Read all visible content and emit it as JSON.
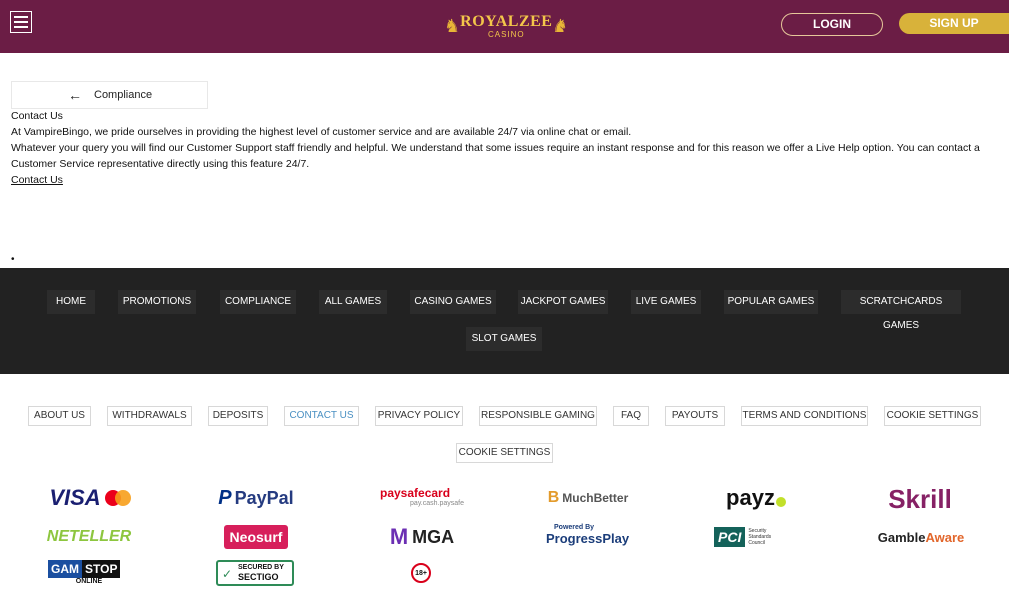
{
  "header": {
    "brand": "ROYALZEE",
    "brand_sub": "CASINO",
    "login": "LOGIN",
    "signup": "SIGN UP"
  },
  "back_label": "Compliance",
  "content": {
    "title": "Contact Us",
    "p1": "At VampireBingo, we pride ourselves in providing the highest level of customer service and are available 24/7 via online chat or email.",
    "p2": "Whatever your query you will find our Customer Support staff friendly and helpful. We understand that some issues require an instant response and for this reason we offer a Live Help option. You can contact a Customer Service representative directly using this feature 24/7.",
    "link": "Contact Us",
    "bullet": "•"
  },
  "footer_nav": [
    "HOME",
    "PROMOTIONS",
    "COMPLIANCE",
    "ALL GAMES",
    "CASINO GAMES",
    "JACKPOT GAMES",
    "LIVE GAMES",
    "POPULAR GAMES",
    "SCRATCHCARDS GAMES",
    "SLOT GAMES"
  ],
  "footer_links": [
    "ABOUT US",
    "WITHDRAWALS",
    "DEPOSITS",
    "CONTACT US",
    "PRIVACY POLICY",
    "RESPONSIBLE GAMING",
    "FAQ",
    "PAYOUTS",
    "TERMS AND CONDITIONS",
    "COOKIE SETTINGS",
    "COOKIE SETTINGS"
  ],
  "payments": {
    "visa": "VISA",
    "paypal": "PayPal",
    "paysafecard": "paysafecard",
    "paysafecard_sub": "pay.cash.paysafe",
    "muchbetter": "MuchBetter",
    "payz": "payz",
    "skrill": "Skrill",
    "neteller": "NETELLER",
    "neosurf": "Neosurf",
    "mga": "MGA",
    "progress_top": "Powered By",
    "progress": "ProgressPlay",
    "pci": "PCI",
    "pci_sub": "Security Standards Council",
    "gamble": "Gamble",
    "aware": "Aware",
    "gamstop_a": "GAM",
    "gamstop_b": "STOP",
    "gamstop_sub": "ONLINE",
    "sectigo_a": "SECURED BY",
    "sectigo_b": "SECTIGO",
    "age": "18+"
  },
  "colors": {
    "header_bg": "#6b1d45",
    "gold": "#d8b23a",
    "footer_dark": "#222222",
    "active_link": "#4a90c2"
  }
}
